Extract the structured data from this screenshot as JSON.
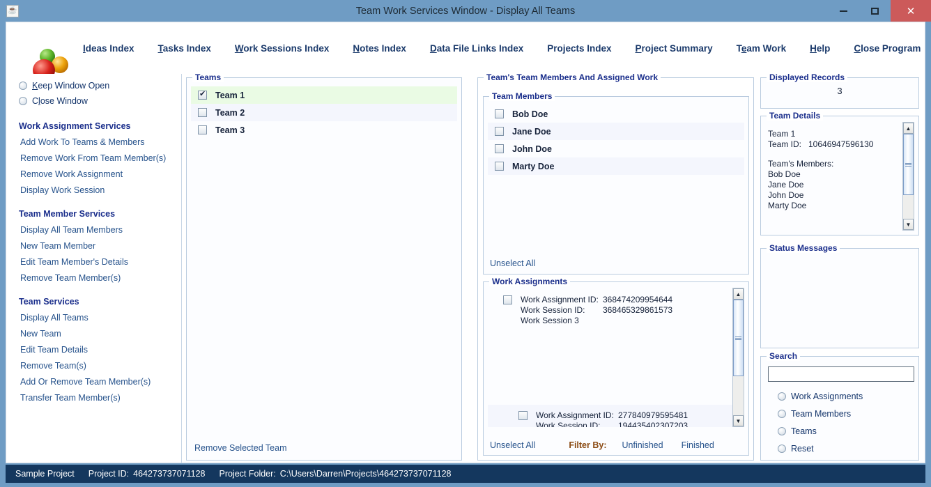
{
  "window": {
    "title": "Team Work Services Window - Display All Teams",
    "icon": "java-coffee-icon",
    "minimize": "minimize-icon",
    "maximize": "maximize-icon",
    "close": "close-icon"
  },
  "menu": {
    "logo_name": "three-spheres-logo",
    "items": [
      {
        "label": "Ideas Index",
        "mnemonic": "I"
      },
      {
        "label": "Tasks Index",
        "mnemonic": "T"
      },
      {
        "label": "Work Sessions Index",
        "mnemonic": "W"
      },
      {
        "label": "Notes Index",
        "mnemonic": "N"
      },
      {
        "label": "Data File Links Index",
        "mnemonic": "D"
      },
      {
        "label": "Projects Index",
        "mnemonic": "P"
      },
      {
        "label": "Project Summary",
        "mnemonic": "P"
      },
      {
        "label": "Team Work",
        "mnemonic": "e"
      },
      {
        "label": "Help",
        "mnemonic": "H"
      },
      {
        "label": "Close Program",
        "mnemonic": "C"
      }
    ]
  },
  "sidebar": {
    "radios": [
      {
        "label": "Keep Window Open",
        "mnemonic": "K",
        "selected": false
      },
      {
        "label": "Close Window",
        "mnemonic": "l",
        "selected": false
      }
    ],
    "sections": [
      {
        "heading": "Work Assignment Services",
        "links": [
          "Add Work To Teams & Members",
          "Remove Work From Team Member(s)",
          "Remove Work Assignment",
          "Display Work Session"
        ]
      },
      {
        "heading": "Team Member Services",
        "links": [
          "Display All Team Members",
          "New Team Member",
          "Edit Team Member's Details",
          "Remove Team Member(s)"
        ]
      },
      {
        "heading": "Team Services",
        "links": [
          "Display All Teams",
          "New Team",
          "Edit Team Details",
          "Remove Team(s)",
          "Add Or Remove Team Member(s)",
          "Transfer Team Member(s)"
        ]
      }
    ]
  },
  "teams_panel": {
    "legend": "Teams",
    "rows": [
      {
        "label": "Team 1",
        "checked": true,
        "selected": true
      },
      {
        "label": "Team 2",
        "checked": false,
        "selected": false
      },
      {
        "label": "Team 3",
        "checked": false,
        "selected": false
      }
    ],
    "remove_link": "Remove Selected Team"
  },
  "members_panel": {
    "legend": "Team's Team Members And Assigned Work",
    "members_legend": "Team Members",
    "members": [
      {
        "label": "Bob Doe",
        "checked": false
      },
      {
        "label": "Jane Doe",
        "checked": false
      },
      {
        "label": "John Doe",
        "checked": false
      },
      {
        "label": "Marty Doe",
        "checked": false
      }
    ],
    "unselect_all": "Unselect All"
  },
  "work_assignments": {
    "legend": "Work Assignments",
    "items": [
      {
        "checked": false,
        "assignment_label": "Work Assignment ID:",
        "assignment_id": "368474209954644",
        "session_label": "Work Session ID:",
        "session_id": "368465329861573",
        "session_name": "Work Session 3"
      },
      {
        "checked": false,
        "assignment_label": "Work Assignment ID:",
        "assignment_id": "277840979595481",
        "session_label": "Work Session ID:",
        "session_id": "194435402307203",
        "session_name": ""
      }
    ],
    "unselect_all": "Unselect All",
    "filter_by_label": "Filter By:",
    "filter_unfinished": "Unfinished",
    "filter_finished": "Finished"
  },
  "displayed_records": {
    "legend": "Displayed Records",
    "count": "3"
  },
  "team_details": {
    "legend": "Team Details",
    "team_name": "Team 1",
    "team_id_label": "Team ID:",
    "team_id": "10646947596130",
    "members_heading": "Team's Members:",
    "members": [
      "Bob Doe",
      "Jane Doe",
      "John Doe",
      "Marty Doe"
    ]
  },
  "status_messages": {
    "legend": "Status Messages",
    "text": ""
  },
  "search": {
    "legend": "Search",
    "value": "",
    "placeholder": "",
    "options": [
      {
        "label": "Work Assignments",
        "selected": false
      },
      {
        "label": "Team Members",
        "selected": false
      },
      {
        "label": "Teams",
        "selected": false
      },
      {
        "label": "Reset",
        "selected": false
      }
    ]
  },
  "statusbar": {
    "project_name": "Sample Project",
    "project_id_label": "Project ID:",
    "project_id": "464273737071128",
    "project_folder_label": "Project Folder:",
    "project_folder": "C:\\Users\\Darren\\Projects\\464273737071128"
  }
}
